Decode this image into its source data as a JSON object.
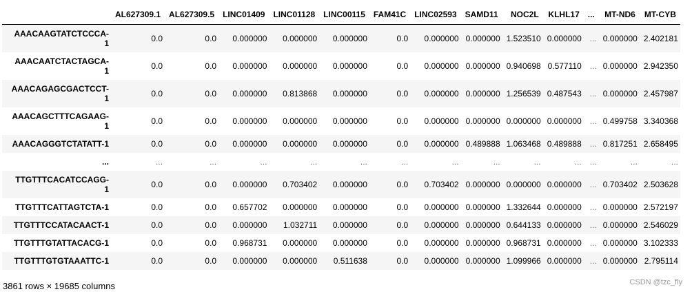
{
  "table": {
    "columns": [
      "AL627309.1",
      "AL627309.5",
      "LINC01409",
      "LINC01128",
      "LINC00115",
      "FAM41C",
      "LINC02593",
      "SAMD11",
      "NOC2L",
      "KLHL17",
      "...",
      "MT-ND6",
      "MT-CYB"
    ],
    "rows": [
      {
        "index_lines": [
          "AAACAAGTATCTCCCA-",
          "1"
        ],
        "cells": [
          "0.0",
          "0.0",
          "0.000000",
          "0.000000",
          "0.000000",
          "0.0",
          "0.000000",
          "0.000000",
          "1.523510",
          "0.000000",
          "...",
          "0.000000",
          "2.402181"
        ]
      },
      {
        "index_lines": [
          "AAACAATCTACTAGCA-",
          "1"
        ],
        "cells": [
          "0.0",
          "0.0",
          "0.000000",
          "0.000000",
          "0.000000",
          "0.0",
          "0.000000",
          "0.000000",
          "0.940698",
          "0.577110",
          "...",
          "0.000000",
          "2.942350"
        ]
      },
      {
        "index_lines": [
          "AAACAGAGCGACTCCT-",
          "1"
        ],
        "cells": [
          "0.0",
          "0.0",
          "0.000000",
          "0.813868",
          "0.000000",
          "0.0",
          "0.000000",
          "0.000000",
          "1.256539",
          "0.487543",
          "...",
          "0.000000",
          "2.457987"
        ]
      },
      {
        "index_lines": [
          "AAACAGCTTTCAGAAG-",
          "1"
        ],
        "cells": [
          "0.0",
          "0.0",
          "0.000000",
          "0.000000",
          "0.000000",
          "0.0",
          "0.000000",
          "0.000000",
          "0.000000",
          "0.000000",
          "...",
          "0.499758",
          "3.340368"
        ]
      },
      {
        "index_lines": [
          "AAACAGGGTCTATATT-1"
        ],
        "cells": [
          "0.0",
          "0.0",
          "0.000000",
          "0.000000",
          "0.000000",
          "0.0",
          "0.000000",
          "0.489888",
          "1.063468",
          "0.489888",
          "...",
          "0.817251",
          "2.658495"
        ]
      },
      {
        "index_lines": [
          "..."
        ],
        "cells": [
          "...",
          "...",
          "...",
          "...",
          "...",
          "...",
          "...",
          "...",
          "...",
          "...",
          "...",
          "...",
          "..."
        ]
      },
      {
        "index_lines": [
          "TTGTTTCACATCCAGG-",
          "1"
        ],
        "cells": [
          "0.0",
          "0.0",
          "0.000000",
          "0.703402",
          "0.000000",
          "0.0",
          "0.703402",
          "0.000000",
          "0.000000",
          "0.000000",
          "...",
          "0.703402",
          "2.503628"
        ]
      },
      {
        "index_lines": [
          "TTGTTTCATTAGTCTA-1"
        ],
        "cells": [
          "0.0",
          "0.0",
          "0.657702",
          "0.000000",
          "0.000000",
          "0.0",
          "0.000000",
          "0.000000",
          "1.332644",
          "0.000000",
          "...",
          "0.000000",
          "2.572197"
        ]
      },
      {
        "index_lines": [
          "TTGTTTCCATACAACT-1"
        ],
        "cells": [
          "0.0",
          "0.0",
          "0.000000",
          "1.032711",
          "0.000000",
          "0.0",
          "0.000000",
          "0.000000",
          "0.644133",
          "0.000000",
          "...",
          "0.000000",
          "2.546029"
        ]
      },
      {
        "index_lines": [
          "TTGTTTGTATTACACG-1"
        ],
        "cells": [
          "0.0",
          "0.0",
          "0.968731",
          "0.000000",
          "0.000000",
          "0.0",
          "0.000000",
          "0.000000",
          "0.968731",
          "0.000000",
          "...",
          "0.000000",
          "3.102333"
        ]
      },
      {
        "index_lines": [
          "TTGTTTGTGTAAATTC-1"
        ],
        "cells": [
          "0.0",
          "0.0",
          "0.000000",
          "0.000000",
          "0.511638",
          "0.0",
          "0.000000",
          "0.000000",
          "1.099966",
          "0.000000",
          "...",
          "0.000000",
          "2.795114"
        ]
      }
    ]
  },
  "shape_text": "3861 rows × 19685 columns",
  "watermark": "CSDN @tzc_fly"
}
